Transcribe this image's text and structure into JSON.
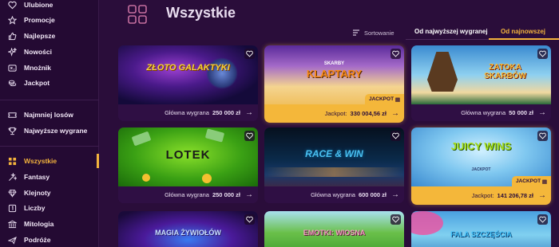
{
  "sidebar": {
    "items": [
      {
        "label": "Ulubione",
        "icon": "heart-icon"
      },
      {
        "label": "Promocje",
        "icon": "star-icon"
      },
      {
        "label": "Najlepsze",
        "icon": "thumbs-up-icon"
      },
      {
        "label": "Nowości",
        "icon": "sparkle-icon"
      },
      {
        "label": "Mnożnik",
        "icon": "multiplier-icon"
      },
      {
        "label": "Jackpot",
        "icon": "coins-icon"
      },
      {
        "label": "Najmniej losów",
        "icon": "ticket-icon"
      },
      {
        "label": "Najwyższe wygrane",
        "icon": "trophy-icon"
      },
      {
        "label": "Wszystkie",
        "icon": "grid-icon"
      },
      {
        "label": "Fantasy",
        "icon": "wand-icon"
      },
      {
        "label": "Klejnoty",
        "icon": "diamond-icon"
      },
      {
        "label": "Liczby",
        "icon": "numbers-icon"
      },
      {
        "label": "Mitologia",
        "icon": "temple-icon"
      },
      {
        "label": "Podróże",
        "icon": "plane-icon"
      }
    ],
    "active": "Wszystkie"
  },
  "header": {
    "title": "Wszystkie"
  },
  "sort": {
    "label": "Sortowanie",
    "options": [
      "Od najwyższej wygranej",
      "Od najnowszej"
    ],
    "selected": "Od najnowszej"
  },
  "cards": [
    {
      "name": "Złoto Galaktyki",
      "logo": "ZŁOTO GALAKTYKI",
      "prize_label": "Główna wygrana",
      "prize": "250 000 zł",
      "jackpot": false
    },
    {
      "name": "Skarby Klaptary",
      "logo": "KLAPTARY",
      "logo_top": "SKARBY",
      "prize_label": "Jackpot:",
      "prize": "330 004,56 zł",
      "jackpot": true,
      "badge": "JACKPOT"
    },
    {
      "name": "Zatoka Skarbów",
      "logo": "ZATOKA SKARBÓW",
      "prize_label": "Główna wygrana",
      "prize": "50 000 zł",
      "jackpot": false
    },
    {
      "name": "Lotek",
      "logo": "LOTEK",
      "prize_label": "Główna wygrana",
      "prize": "250 000 zł",
      "jackpot": false
    },
    {
      "name": "Race & Win",
      "logo": "RACE & WIN",
      "prize_label": "Główna wygrana",
      "prize": "600 000 zł",
      "jackpot": false
    },
    {
      "name": "Juicy Wins",
      "logo": "JUICY WINS",
      "logo_sub": "JACKPOT",
      "prize_label": "Jackpot:",
      "prize": "141 206,78 zł",
      "jackpot": true,
      "badge": "JACKPOT"
    },
    {
      "name": "Magia Żywiołów",
      "logo": "MAGIA ŻYWIOŁÓW"
    },
    {
      "name": "Emotki: Wiosna",
      "logo": "EMOTKI: WIOSNA"
    },
    {
      "name": "Fala Szczęścia",
      "logo": "FALA SZCZĘŚCIA"
    }
  ],
  "colors": {
    "background": "#2a0d3a",
    "sidebar": "#240a33",
    "accent": "#f3b33d",
    "jackpot_bar": "#f4b73a"
  }
}
